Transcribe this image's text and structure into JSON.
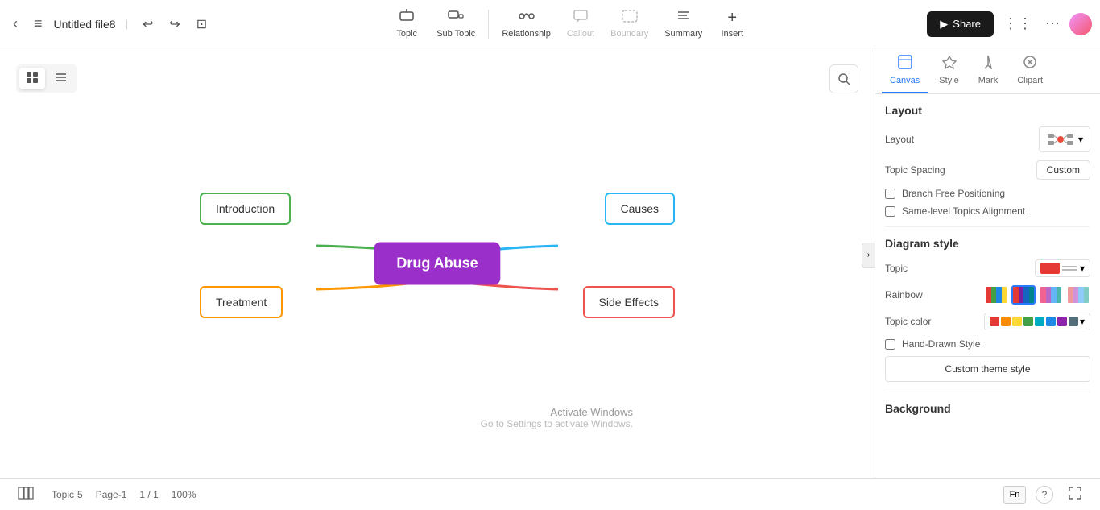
{
  "app": {
    "title": "Untitled file8",
    "share_label": "Share"
  },
  "toolbar": {
    "back_label": "‹",
    "undo_icon": "↩",
    "redo_icon": "↪",
    "clip_icon": "⊡",
    "topic_label": "Topic",
    "subtopic_label": "Sub Topic",
    "relationship_label": "Relationship",
    "callout_label": "Callout",
    "boundary_label": "Boundary",
    "summary_label": "Summary",
    "insert_label": "Insert",
    "menu_icon": "≡",
    "grid_icon": "⋮⋮",
    "more_icon": "⋯"
  },
  "view_toggle": {
    "card_view_label": "▦",
    "list_view_label": "☰"
  },
  "panel_tabs": [
    {
      "id": "canvas",
      "label": "Canvas",
      "icon": "⬜",
      "active": true
    },
    {
      "id": "style",
      "label": "Style",
      "icon": "✦"
    },
    {
      "id": "mark",
      "label": "Mark",
      "icon": "📍"
    },
    {
      "id": "clipart",
      "label": "Clipart",
      "icon": "✂"
    }
  ],
  "layout_section": {
    "title": "Layout",
    "layout_label": "Layout",
    "topic_spacing_label": "Topic Spacing",
    "custom_label": "Custom",
    "branch_free_label": "Branch Free Positioning",
    "same_level_label": "Same-level Topics Alignment"
  },
  "diagram_style": {
    "title": "Diagram style",
    "topic_label": "Topic",
    "rainbow_label": "Rainbow",
    "topic_color_label": "Topic color",
    "hand_drawn_label": "Hand-Drawn Style",
    "custom_theme_label": "Custom theme style",
    "background_label": "Background"
  },
  "mindmap": {
    "central_node": "Drug Abuse",
    "nodes": [
      {
        "id": "introduction",
        "label": "Introduction",
        "color": "#4caf50"
      },
      {
        "id": "treatment",
        "label": "Treatment",
        "color": "#ff9800"
      },
      {
        "id": "causes",
        "label": "Causes",
        "color": "#29b6f6"
      },
      {
        "id": "sideeffects",
        "label": "Side Effects",
        "color": "#ef5350"
      }
    ]
  },
  "status_bar": {
    "topic_label": "Topic",
    "topic_count": "5",
    "page_label": "Page-1",
    "page_info": "1 / 1",
    "zoom": "100%"
  },
  "rainbow_swatches": [
    {
      "colors": [
        "#e53935",
        "#43a047",
        "#1e88e5",
        "#fdd835"
      ],
      "active": false
    },
    {
      "colors": [
        "#e53935",
        "#7b1fa2",
        "#1565c0",
        "#00838f"
      ],
      "active": true
    },
    {
      "colors": [
        "#f06292",
        "#ba68c8",
        "#64b5f6",
        "#4db6ac"
      ],
      "active": false
    },
    {
      "colors": [
        "#ef9a9a",
        "#ce93d8",
        "#90caf9",
        "#80cbc4"
      ],
      "active": false
    }
  ],
  "topic_colors": [
    "#e53935",
    "#fb8c00",
    "#fdd835",
    "#43a047",
    "#00acc1",
    "#1e88e5",
    "#8e24aa",
    "#546e7a"
  ],
  "watermark": {
    "line1": "Activate Windows",
    "line2": "Go to Settings to activate Windows."
  }
}
